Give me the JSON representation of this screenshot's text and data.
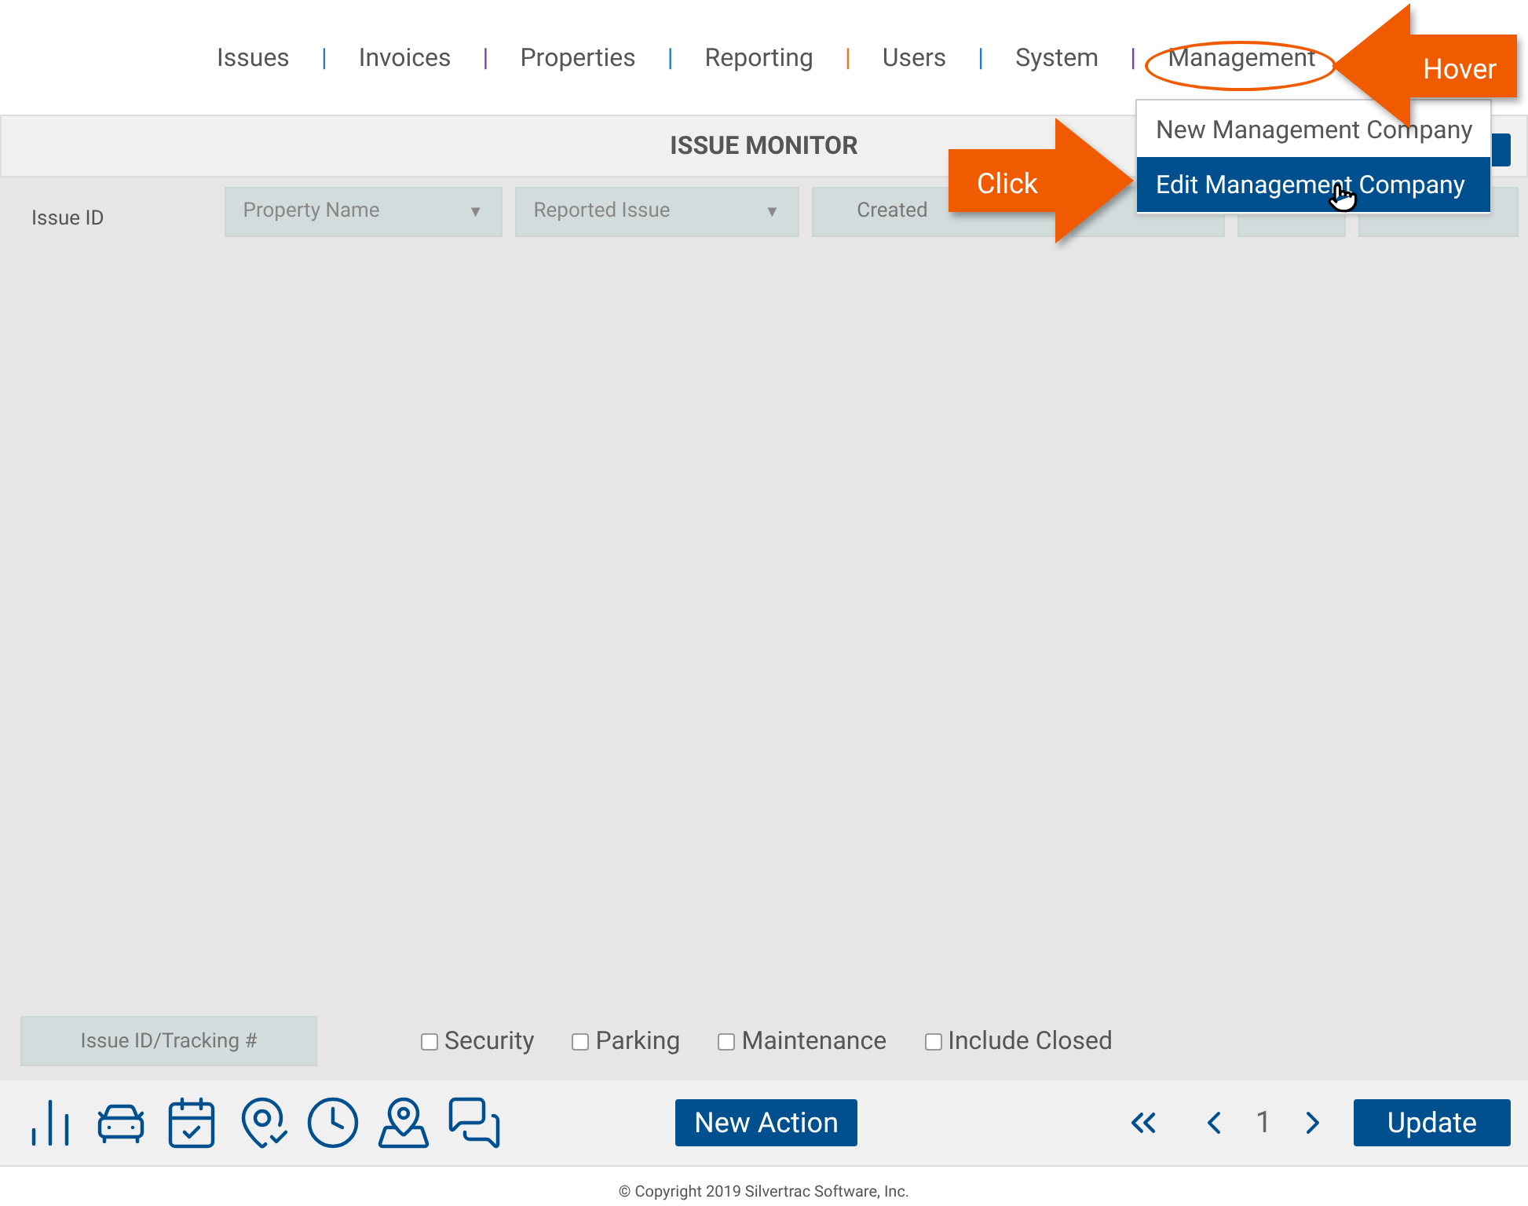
{
  "nav": [
    {
      "label": "Issues",
      "separator": "|",
      "color": "#2b7bb9"
    },
    {
      "label": "Invoices",
      "separator": "|",
      "color": "#7b3fa0"
    },
    {
      "label": "Properties",
      "separator": "|",
      "color": "#2b7bb9"
    },
    {
      "label": "Reporting",
      "separator": "|",
      "color": "#e07b20"
    },
    {
      "label": "Users",
      "separator": "|",
      "color": "#2b7bb9"
    },
    {
      "label": "System",
      "separator": "|",
      "color": "#7b3fa0"
    },
    {
      "label": "Management"
    }
  ],
  "dropdown": [
    {
      "label": "New Management Company",
      "selected": false
    },
    {
      "label": "Edit Management Company",
      "selected": true
    }
  ],
  "callouts": [
    {
      "label": "Hover",
      "kind": "left"
    },
    {
      "label": "Click",
      "kind": "right"
    }
  ],
  "monitor": {
    "title": "ISSUE MONITOR",
    "id_label": "Issue ID",
    "filters": [
      {
        "kind": "select",
        "label": "Property Name",
        "caret": "▼"
      },
      {
        "kind": "select",
        "label": "Reported Issue",
        "caret": "▼"
      },
      {
        "kind": "text",
        "label": "Created"
      },
      {
        "kind": "blank"
      },
      {
        "kind": "blank"
      },
      {
        "kind": "blank"
      }
    ]
  },
  "search": {
    "placeholder": "Issue ID/Tracking #"
  },
  "checkboxes": [
    {
      "label": "Security",
      "checked": false
    },
    {
      "label": "Parking",
      "checked": false
    },
    {
      "label": "Maintenance",
      "checked": false
    },
    {
      "label": "Include Closed",
      "checked": false
    }
  ],
  "toolbar": {
    "new_action": "New Action",
    "page": "1",
    "update": "Update"
  },
  "footer": "© Copyright 2019 Silvertrac Software, Inc."
}
